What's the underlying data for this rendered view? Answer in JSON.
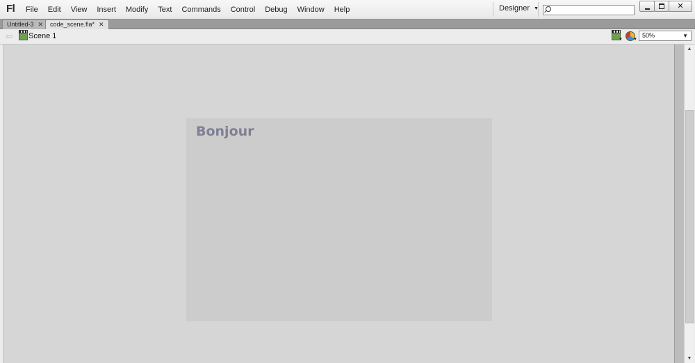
{
  "app": {
    "logo": "Fl",
    "menu": [
      "File",
      "Edit",
      "View",
      "Insert",
      "Modify",
      "Text",
      "Commands",
      "Control",
      "Debug",
      "Window",
      "Help"
    ],
    "workspace_label": "Designer",
    "search_placeholder": ""
  },
  "tabs": [
    {
      "label": "Untitled-3",
      "active": false
    },
    {
      "label": "code_scene.fla*",
      "active": true
    }
  ],
  "editbar": {
    "scene_label": "Scene 1",
    "zoom": "50%"
  },
  "stage": {
    "text": "Bonjour",
    "text_color": "#7f7f95",
    "background": "#cccccc"
  }
}
